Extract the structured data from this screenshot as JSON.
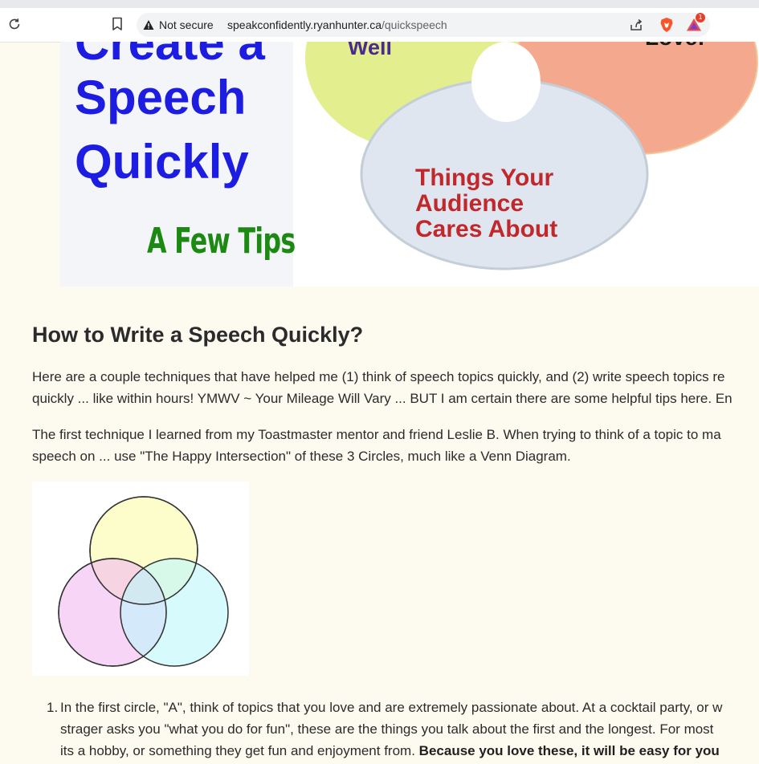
{
  "browser": {
    "security_label": "Not secure",
    "url_host": "speakconfidently.ryanhunter.ca",
    "url_path": "/quickspeech",
    "rewards_badge": "1"
  },
  "hero": {
    "title_line1": "Create a",
    "title_line2": "Speech",
    "title_line3": "Quickly",
    "subtitle": "A Few Tips",
    "circle_top_left_label": "Well",
    "circle_top_right_label": "Love!",
    "circle_bottom_label_1": "Things Your",
    "circle_bottom_label_2": "Audience",
    "circle_bottom_label_3": "Cares About"
  },
  "article": {
    "heading": "How to Write a Speech Quickly?",
    "intro_line1": "Here are a couple techniques that have helped me (1) think of speech topics quickly, and (2) write speech topics re",
    "intro_line2": "quickly ... like within hours! YMWV ~ Your Mileage Will Vary ... BUT I am certain there are some helpful tips here. En",
    "p2_line1": "The first technique I learned from my Toastmaster mentor and friend Leslie B. When trying to think of a topic to ma",
    "p2_line2": "speech on ... use \"The Happy Intersection\" of these 3 Circles, much like a Venn Diagram.",
    "list_number": "1.",
    "li1_line1": "In the first circle, \"A\", think of topics that you love and are extremely passionate about. At a cocktail party, or w",
    "li1_line2": "strager asks you \"what you do for fun\", these are the things you talk about the first and the longest. For most",
    "li1_line3_plain": "its a hobby, or something they get fun and enjoyment from. ",
    "li1_line3_bold": "Because you love these, it will be easy for you"
  },
  "colors": {
    "hero_title": "#1c1de0",
    "hero_tips": "#1c8a12",
    "hero_red_text": "#c0282b",
    "hero_purple_text": "#4a2a8a",
    "page_bg": "#fdfaf0"
  }
}
